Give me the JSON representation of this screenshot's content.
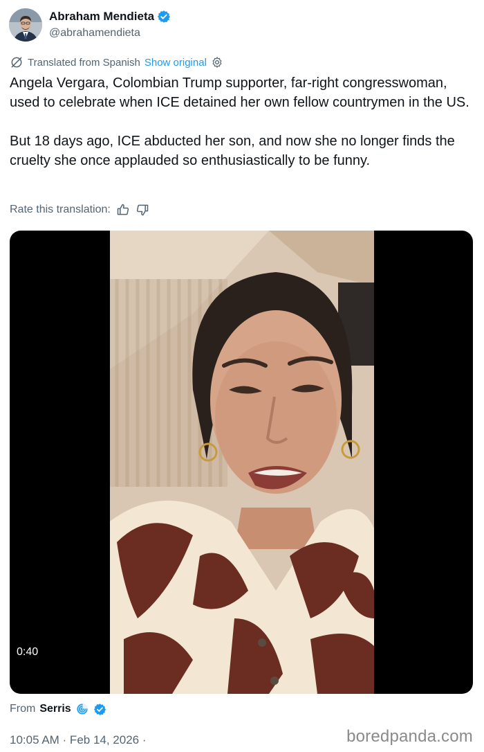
{
  "author": {
    "name": "Abraham Mendieta",
    "handle": "@abrahamendieta"
  },
  "translation": {
    "label": "Translated from Spanish",
    "show_original": "Show original",
    "rate_label": "Rate this translation:"
  },
  "tweet": {
    "text": "Angela Vergara, Colombian Trump supporter, far-right congresswoman, used to celebrate when ICE detained her own fellow countrymen in the US.\n\nBut 18 days ago, ICE abducted her son, and now she no longer finds the cruelty she once applauded so enthusiastically to be funny."
  },
  "media": {
    "duration": "0:40"
  },
  "source": {
    "prefix": "From",
    "name": "Serris"
  },
  "timestamp": "10:05 AM · Feb 14, 2026 ·",
  "watermark": "boredpanda.com",
  "colors": {
    "link": "#1d9bf0",
    "verified": "#1d9bf0",
    "muted": "#536471"
  }
}
